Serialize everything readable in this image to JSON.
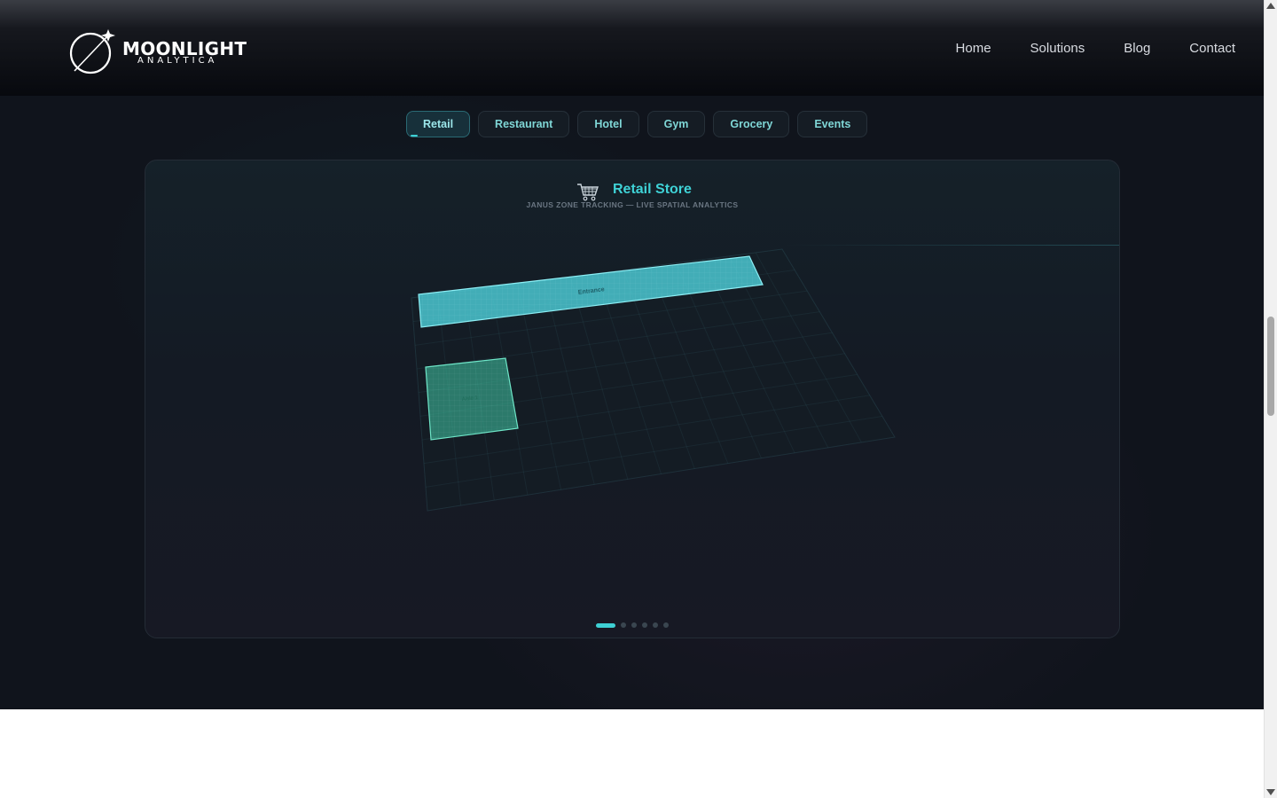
{
  "brand": {
    "name": "MOONLIGHT",
    "tagline": "ANALYTICA"
  },
  "nav": [
    {
      "label": "Home"
    },
    {
      "label": "Solutions"
    },
    {
      "label": "Blog"
    },
    {
      "label": "Contact"
    }
  ],
  "tabs": [
    {
      "label": "Retail",
      "active": true
    },
    {
      "label": "Restaurant"
    },
    {
      "label": "Hotel"
    },
    {
      "label": "Gym"
    },
    {
      "label": "Grocery"
    },
    {
      "label": "Events"
    }
  ],
  "card": {
    "icon": "shopping-cart-icon",
    "title": "Retail Store",
    "subtitle": "JANUS ZONE TRACKING — LIVE SPATIAL ANALYTICS",
    "zones": [
      {
        "label": "Entrance",
        "color": "#4fd6e0"
      },
      {
        "label": "Aisle 1",
        "color": "#3fc8a6"
      }
    ],
    "carousel": {
      "count": 6,
      "active": 1
    }
  },
  "colors": {
    "accent": "#3ed0d4",
    "background": "#10141c"
  }
}
